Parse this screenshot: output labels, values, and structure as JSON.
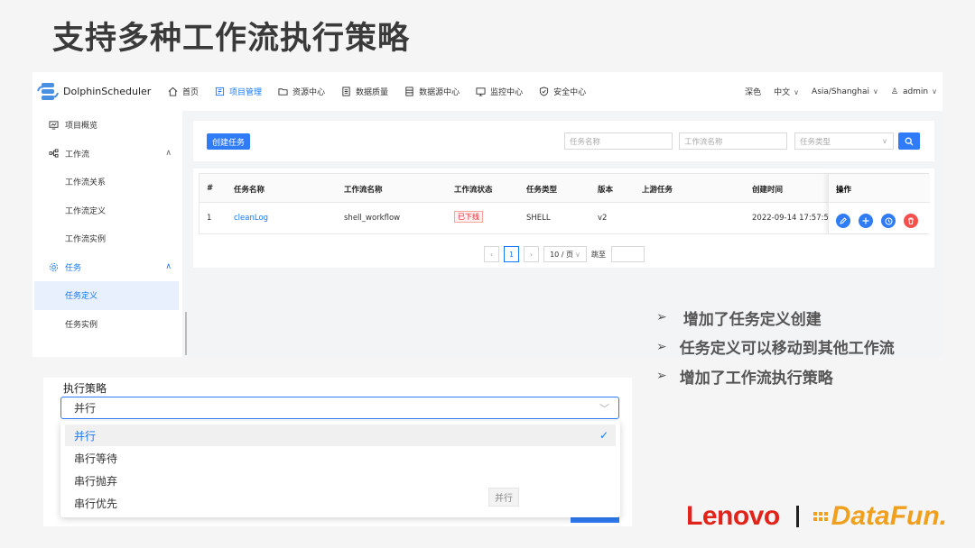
{
  "slide": {
    "title": "支持多种工作流执行策略"
  },
  "topbar": {
    "logo": "DolphinScheduler",
    "nav": [
      {
        "label": "首页",
        "icon": "home-icon"
      },
      {
        "label": "项目管理",
        "icon": "project-icon",
        "active": true
      },
      {
        "label": "资源中心",
        "icon": "folder-icon"
      },
      {
        "label": "数据质量",
        "icon": "data-quality-icon"
      },
      {
        "label": "数据源中心",
        "icon": "datasource-icon"
      },
      {
        "label": "监控中心",
        "icon": "monitor-icon"
      },
      {
        "label": "安全中心",
        "icon": "shield-icon"
      }
    ],
    "theme": "深色",
    "language": "中文",
    "timezone": "Asia/Shanghai",
    "user": "admin"
  },
  "sidebar": {
    "items": [
      {
        "label": "项目概览"
      },
      {
        "label": "工作流"
      },
      {
        "label": "工作流关系"
      },
      {
        "label": "工作流定义"
      },
      {
        "label": "工作流实例"
      },
      {
        "label": "任务"
      },
      {
        "label": "任务定义"
      },
      {
        "label": "任务实例"
      }
    ]
  },
  "toolbar": {
    "create_label": "创建任务",
    "task_name_placeholder": "任务名称",
    "workflow_name_placeholder": "工作流名称",
    "task_type_placeholder": "任务类型"
  },
  "table": {
    "columns": [
      "#",
      "任务名称",
      "工作流名称",
      "工作流状态",
      "任务类型",
      "版本",
      "上游任务",
      "创建时间",
      "操作"
    ],
    "rows": [
      {
        "index": "1",
        "task_name": "cleanLog",
        "workflow_name": "shell_workflow",
        "status": "已下线",
        "task_type": "SHELL",
        "version": "v2",
        "upstream": "",
        "created": "2022-09-14 17:57:5"
      }
    ]
  },
  "pagination": {
    "current_page": "1",
    "page_size": "10 / 页",
    "jump_label": "跳至"
  },
  "bullets": [
    "增加了任务定义创建",
    "任务定义可以移动到其他工作流",
    "增加了工作流执行策略"
  ],
  "strategy": {
    "label": "执行策略",
    "selected": "并行",
    "options": [
      "并行",
      "串行等待",
      "串行抛弃",
      "串行优先"
    ],
    "tooltip": "并行"
  },
  "brand": {
    "lenovo": "Lenovo",
    "datafun": "DataFun."
  },
  "colors": {
    "primary": "#2f7cf6",
    "danger": "#e2231a",
    "accent": "#f0a01f"
  }
}
